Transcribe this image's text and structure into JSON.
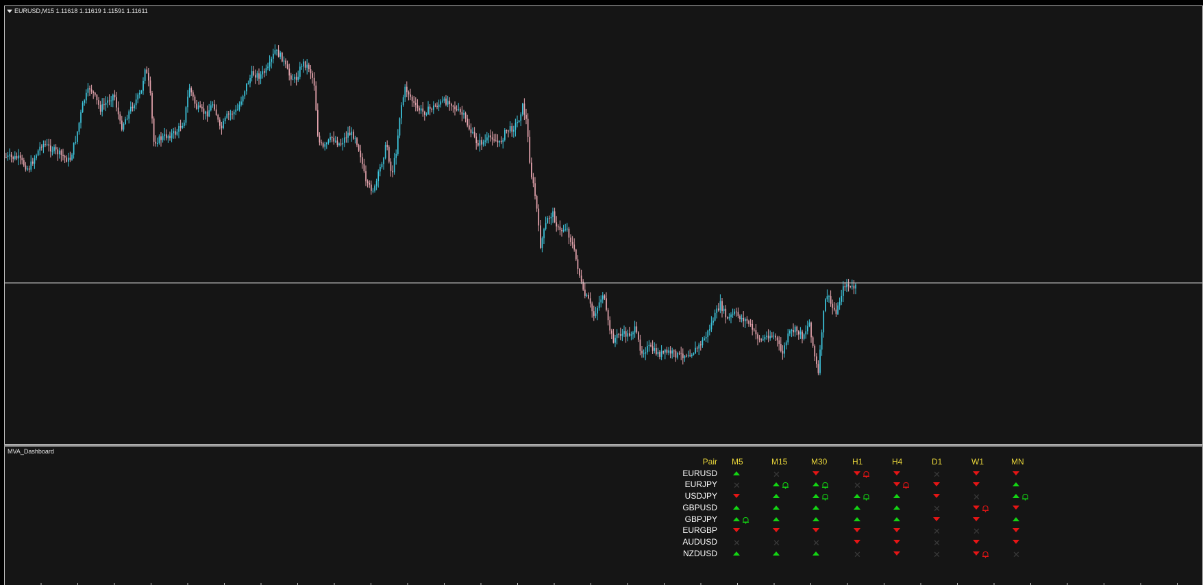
{
  "chart": {
    "symbol_line": "EURUSD,M15  1.11618 1.11619 1.11591 1.11611",
    "colors": {
      "background": "#151515",
      "bull": "#3ec8e0",
      "bear": "#e8a6b0",
      "hline": "#d9d9d9"
    }
  },
  "sub_window": {
    "title": "MVA_Dashboard",
    "headers": [
      "Pair",
      "M5",
      "M15",
      "M30",
      "H1",
      "H4",
      "D1",
      "W1",
      "MN"
    ],
    "rows": [
      {
        "pair": "EURUSD",
        "signals": [
          "up",
          "none",
          "down",
          "down-bell",
          "down",
          "none",
          "down",
          "down"
        ]
      },
      {
        "pair": "EURJPY",
        "signals": [
          "none",
          "up-bell",
          "up-bell",
          "none",
          "down-bell",
          "down",
          "down",
          "up"
        ]
      },
      {
        "pair": "USDJPY",
        "signals": [
          "down",
          "up",
          "up-bell",
          "up-bell",
          "up",
          "down",
          "none",
          "up-bell"
        ]
      },
      {
        "pair": "GBPUSD",
        "signals": [
          "up",
          "up",
          "up",
          "up",
          "up",
          "none",
          "down-bell",
          "down"
        ]
      },
      {
        "pair": "GBPJPY",
        "signals": [
          "up-bell",
          "up",
          "up",
          "up",
          "up",
          "down",
          "down",
          "up"
        ]
      },
      {
        "pair": "EURGBP",
        "signals": [
          "down",
          "down",
          "down",
          "down",
          "down",
          "none",
          "none",
          "down"
        ]
      },
      {
        "pair": "AUDUSD",
        "signals": [
          "none",
          "none",
          "none",
          "down",
          "down",
          "none",
          "down",
          "down"
        ]
      },
      {
        "pair": "NZDUSD",
        "signals": [
          "up",
          "up",
          "up",
          "none",
          "down",
          "none",
          "down-bell",
          "none"
        ]
      }
    ],
    "colors": {
      "header": "#e8d53a",
      "pair": "#ffffff",
      "up": "#13d413",
      "down": "#e61515",
      "none": "#3a3a3a"
    }
  }
}
